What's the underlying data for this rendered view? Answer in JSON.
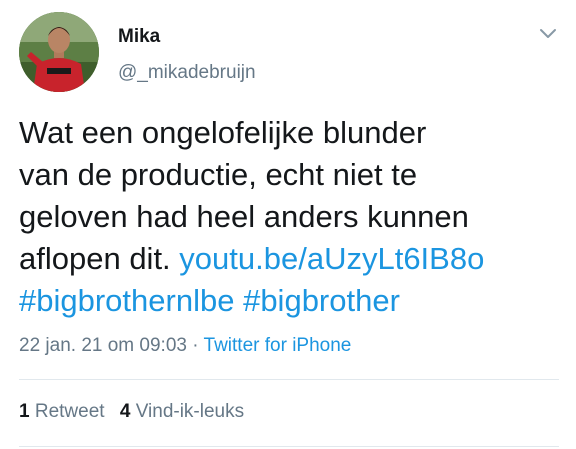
{
  "user": {
    "display_name": "Mika",
    "handle": "@_mikadebruijn"
  },
  "tweet": {
    "line1": "Wat een ongelofelijke blunder",
    "line2": "van de productie, echt niet te",
    "line3": "geloven had heel anders kunnen",
    "line4_text": "aflopen dit.",
    "line4_link": "youtu.be/aUzyLt6IB8o",
    "hashtag1": "#bigbrothernlbe",
    "hashtag2": "#bigbrother"
  },
  "meta": {
    "timestamp": "22 jan. 21 om 09:03",
    "separator": "·",
    "source": "Twitter for iPhone"
  },
  "stats": {
    "retweets_count": "1",
    "retweets_label": "Retweet",
    "likes_count": "4",
    "likes_label": "Vind-ik-leuks"
  },
  "icons": {
    "menu": "chevron-down-icon"
  },
  "colors": {
    "link": "#1b95e0",
    "secondary_text": "#657786",
    "primary_text": "#14171a",
    "divider": "#e1e8ed"
  }
}
